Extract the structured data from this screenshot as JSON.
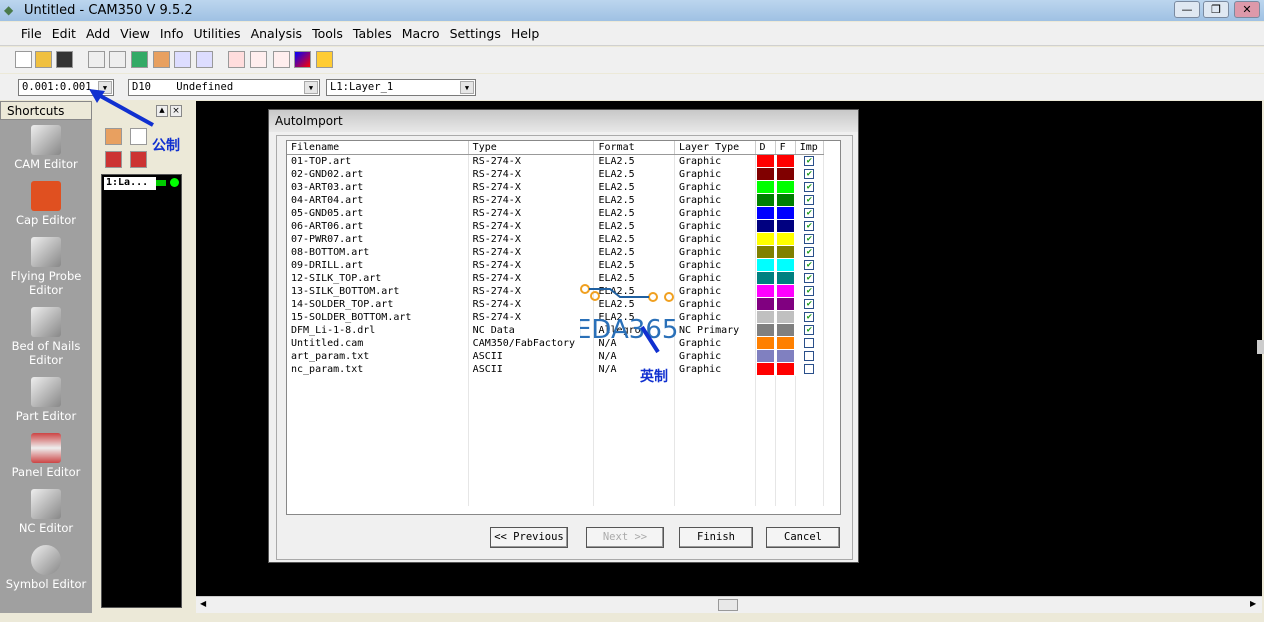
{
  "window": {
    "title": "Untitled - CAM350 V 9.5.2",
    "min": "—",
    "restore": "❐",
    "close": "✕"
  },
  "menu": [
    "File",
    "Edit",
    "Add",
    "View",
    "Info",
    "Utilities",
    "Analysis",
    "Tools",
    "Tables",
    "Macro",
    "Settings",
    "Help"
  ],
  "combos": {
    "grid": "0.001:0.001",
    "dcode": "D10    Undefined",
    "layer": "L1:Layer_1"
  },
  "shortcuts": {
    "header": "Shortcuts",
    "items": [
      "CAM Editor",
      "Cap Editor",
      "Flying Probe Editor",
      "Bed of Nails Editor",
      "Part Editor",
      "Panel Editor",
      "NC Editor",
      "Symbol Editor"
    ]
  },
  "layer_item": "1:La...",
  "annotations": {
    "metric": "公制",
    "imperial": "英制",
    "watermark": "EDA365"
  },
  "dialog": {
    "title": "AutoImport",
    "columns": [
      "Filename",
      "Type",
      "Format",
      "Layer Type",
      "D",
      "F",
      "Imp"
    ],
    "rows": [
      {
        "file": "01-TOP.art",
        "type": "RS-274-X",
        "format": "ELA2.5",
        "layer": "Graphic",
        "color": "#ff0000",
        "imp": true
      },
      {
        "file": "02-GND02.art",
        "type": "RS-274-X",
        "format": "ELA2.5",
        "layer": "Graphic",
        "color": "#800000",
        "imp": true
      },
      {
        "file": "03-ART03.art",
        "type": "RS-274-X",
        "format": "ELA2.5",
        "layer": "Graphic",
        "color": "#00ff00",
        "imp": true
      },
      {
        "file": "04-ART04.art",
        "type": "RS-274-X",
        "format": "ELA2.5",
        "layer": "Graphic",
        "color": "#008000",
        "imp": true
      },
      {
        "file": "05-GND05.art",
        "type": "RS-274-X",
        "format": "ELA2.5",
        "layer": "Graphic",
        "color": "#0000ff",
        "imp": true
      },
      {
        "file": "06-ART06.art",
        "type": "RS-274-X",
        "format": "ELA2.5",
        "layer": "Graphic",
        "color": "#000080",
        "imp": true
      },
      {
        "file": "07-PWR07.art",
        "type": "RS-274-X",
        "format": "ELA2.5",
        "layer": "Graphic",
        "color": "#ffff00",
        "imp": true
      },
      {
        "file": "08-BOTTOM.art",
        "type": "RS-274-X",
        "format": "ELA2.5",
        "layer": "Graphic",
        "color": "#808000",
        "imp": true
      },
      {
        "file": "09-DRILL.art",
        "type": "RS-274-X",
        "format": "ELA2.5",
        "layer": "Graphic",
        "color": "#00ffff",
        "imp": true
      },
      {
        "file": "12-SILK_TOP.art",
        "type": "RS-274-X",
        "format": "ELA2.5",
        "layer": "Graphic",
        "color": "#008080",
        "imp": true
      },
      {
        "file": "13-SILK_BOTTOM.art",
        "type": "RS-274-X",
        "format": "ELA2.5",
        "layer": "Graphic",
        "color": "#ff00ff",
        "imp": true
      },
      {
        "file": "14-SOLDER_TOP.art",
        "type": "RS-274-X",
        "format": "ELA2.5",
        "layer": "Graphic",
        "color": "#800080",
        "imp": true
      },
      {
        "file": "15-SOLDER_BOTTOM.art",
        "type": "RS-274-X",
        "format": "ELA2.5",
        "layer": "Graphic",
        "color": "#c0c0c0",
        "imp": true
      },
      {
        "file": "DFM_Li-1-8.drl",
        "type": "NC Data",
        "format": "Allegro",
        "layer": "NC Primary",
        "color": "#808080",
        "imp": true
      },
      {
        "file": "Untitled.cam",
        "type": "CAM350/FabFactory",
        "format": "N/A",
        "layer": "Graphic",
        "color": "#ff8000",
        "imp": false
      },
      {
        "file": "art_param.txt",
        "type": "ASCII",
        "format": "N/A",
        "layer": "Graphic",
        "color": "#8080c0",
        "imp": false
      },
      {
        "file": "nc_param.txt",
        "type": "ASCII",
        "format": "N/A",
        "layer": "Graphic",
        "color": "#ff0000",
        "imp": false
      }
    ],
    "buttons": {
      "previous": "<< Previous",
      "next": "Next >>",
      "finish": "Finish",
      "cancel": "Cancel"
    }
  }
}
